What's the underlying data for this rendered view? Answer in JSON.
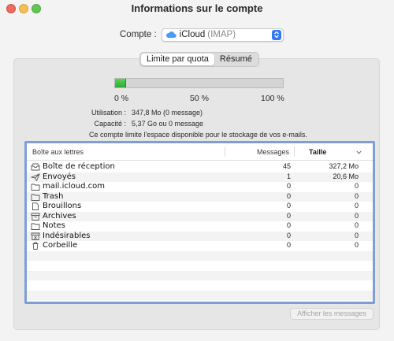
{
  "window": {
    "title": "Informations sur le compte"
  },
  "account": {
    "label": "Compte :",
    "name": "iCloud",
    "type": "(IMAP)"
  },
  "tabs": [
    {
      "label": "Limite par quota",
      "active": true
    },
    {
      "label": "Résumé",
      "active": false
    }
  ],
  "quota": {
    "used_fraction": 0.064,
    "ticks": [
      "0 %",
      "50 %",
      "100 %"
    ],
    "usage_label": "Utilisation :",
    "usage_value": "347,8 Mo (0 message)",
    "capacity_label": "Capacité :",
    "capacity_value": "5,37 Go ou 0 message",
    "note": "Ce compte limite l'espace disponible pour le stockage de vos e-mails.",
    "fill_color": "#35b535"
  },
  "table": {
    "headers": {
      "mailbox": "Boîte aux lettres",
      "messages": "Messages",
      "size": "Taille"
    },
    "rows": [
      {
        "icon": "inbox-icon",
        "name": "Boîte de réception",
        "messages": "45",
        "size": "327,2 Mo"
      },
      {
        "icon": "sent-icon",
        "name": "Envoyés",
        "messages": "1",
        "size": "20,6 Mo"
      },
      {
        "icon": "folder-icon",
        "name": "mail.icloud.com",
        "messages": "0",
        "size": "0"
      },
      {
        "icon": "folder-icon",
        "name": "Trash",
        "messages": "0",
        "size": "0"
      },
      {
        "icon": "draft-icon",
        "name": "Brouillons",
        "messages": "0",
        "size": "0"
      },
      {
        "icon": "archive-icon",
        "name": "Archives",
        "messages": "0",
        "size": "0"
      },
      {
        "icon": "folder-icon",
        "name": "Notes",
        "messages": "0",
        "size": "0"
      },
      {
        "icon": "junk-icon",
        "name": "Indésirables",
        "messages": "0",
        "size": "0"
      },
      {
        "icon": "trash-icon",
        "name": "Corbeille",
        "messages": "0",
        "size": "0"
      }
    ]
  },
  "buttons": {
    "show_messages": "Afficher les messages"
  },
  "colors": {
    "accent": "#3478f6",
    "table_focus_border": "#7d9fd6"
  }
}
